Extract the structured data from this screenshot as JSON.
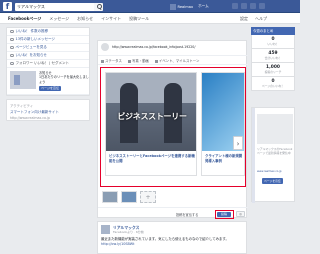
{
  "topbar": {
    "search_value": "リアルマックス",
    "user_name": "Realmax",
    "home_label": "ホーム",
    "find_friends_label": "友達を検索",
    "help_label": "ヘルプ"
  },
  "subnav": {
    "tabs": [
      "Facebookページ",
      "メッセージ",
      "お知らせ",
      "インサイト",
      "投稿ツール"
    ],
    "right_items": [
      "設定",
      "ヘルプ"
    ]
  },
  "left_panel": {
    "stats": [
      {
        "label": "いいね！ 件数の推移"
      },
      {
        "label": "13件の新しいメッセージ"
      },
      {
        "label": "ページビューを見る"
      },
      {
        "label": "いいね！をお知らせ"
      },
      {
        "label": "フォロワー いいね！ | セグメント"
      }
    ],
    "promo_text": "1日あたりのリーチを最大化しましょう",
    "promo_title": "お知らせ",
    "promo_button": "ページを宣伝",
    "suggest_head": "アクティビティ",
    "suggest_title": "スマートフォン向け最新サイト",
    "suggest_url": "http://www.realmax.co.jp"
  },
  "composer": {
    "url": "http://www.realmax.co.jp/facebook_info/post-19220/",
    "tabs": [
      "ステータス",
      "写真・動画",
      "イベント、マイルストーン"
    ],
    "card1_image_caption": "ビジネスストーリー",
    "card1_title": "ビジネスストーリーとFacebookページを連携する新機能を公開",
    "card2_title": "クライアント様の新規開発導入事例",
    "thumb_add": "+",
    "boost_label": "投稿を宣伝する",
    "post_button": "投稿",
    "audience_icon": "globe-icon"
  },
  "feed_post": {
    "name": "リアルマックス",
    "meta": "Facebookより · 6分前",
    "body": "最近また新機能が実装されています。気にしたら使えるものなので紹介してみます。",
    "link": "http://ow.ly/10SBWt"
  },
  "right_panel": {
    "header": "今週のまとめ",
    "stats": [
      {
        "num": "0",
        "label": "いいね！"
      },
      {
        "num": "459",
        "label": "合計いいね！"
      },
      {
        "num": "1,000",
        "label": "投稿のリーチ"
      },
      {
        "num": "0",
        "label": "ページのいいね！"
      }
    ],
    "side_text": "リアルマックスのFacebookページで最新情報を発信中",
    "side_url": "www.realmax.co.jp",
    "side_button": "ページを宣伝"
  }
}
